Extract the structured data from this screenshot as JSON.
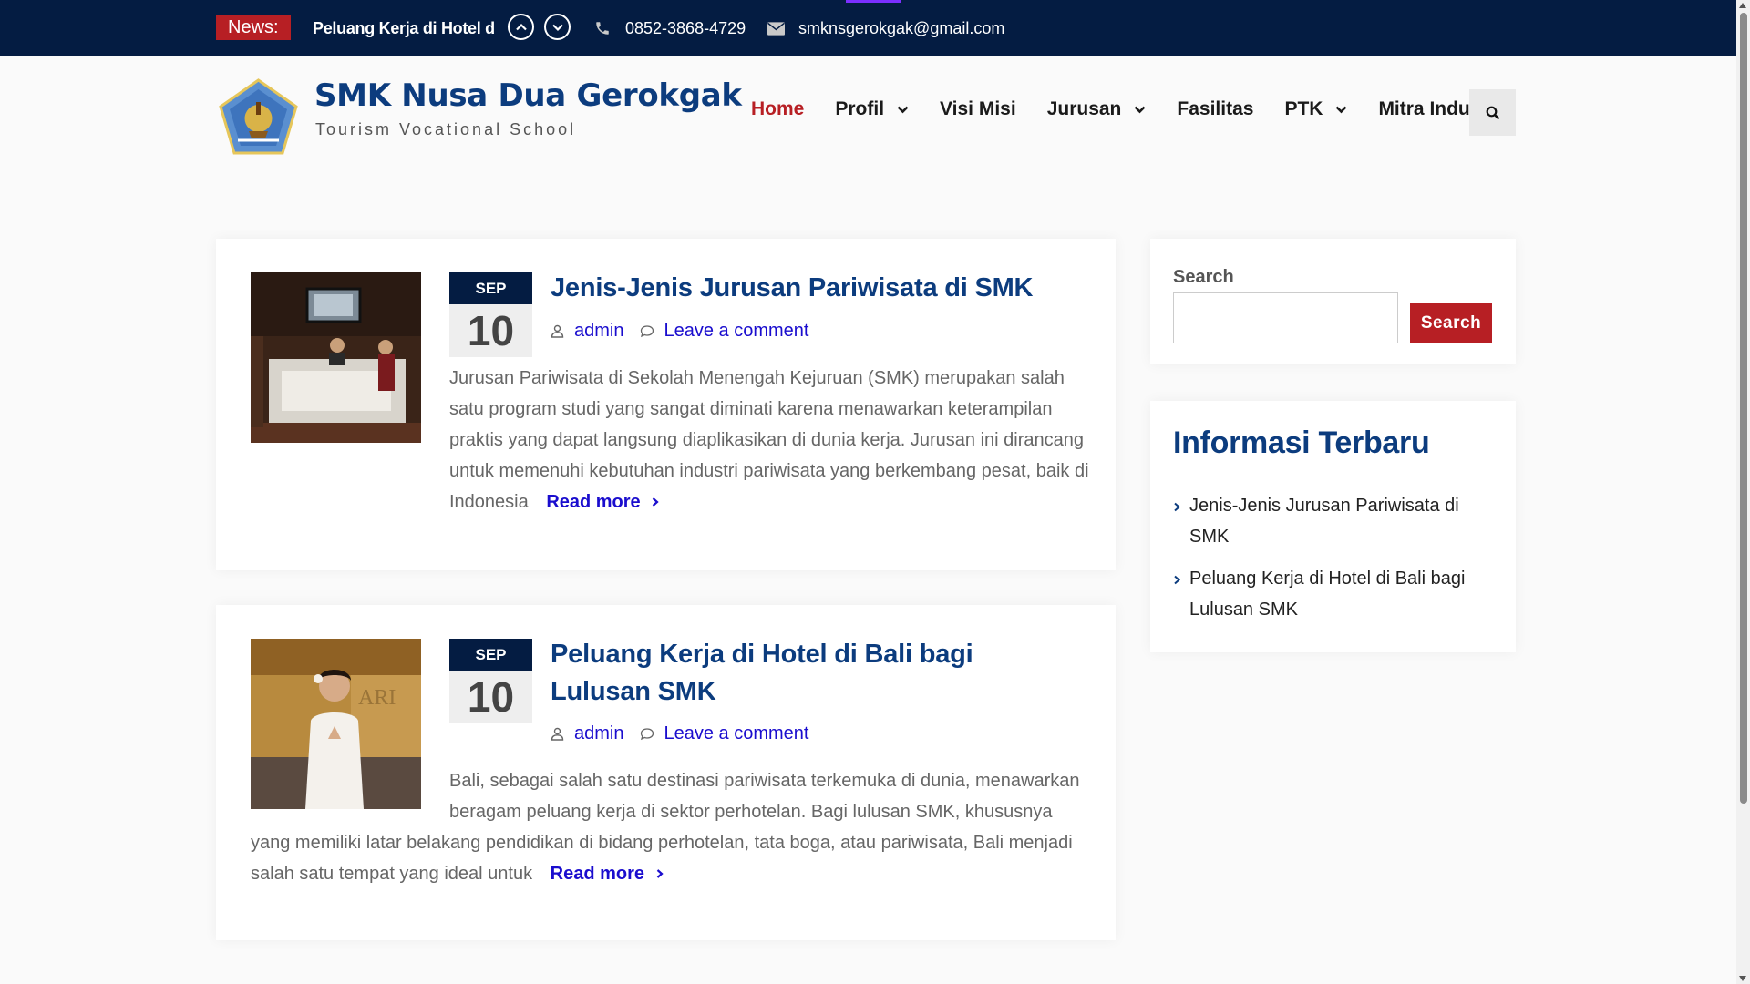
{
  "topbar": {
    "news_label": "News:",
    "ticker_text": "Peluang Kerja di Hotel di",
    "phone": "0852-3868-4729",
    "email": "smknsgerokgak@gmail.com"
  },
  "header": {
    "site_title": "SMK Nusa Dua Gerokgak",
    "tagline": "Tourism Vocational School",
    "nav": [
      {
        "label": "Home",
        "active": true
      },
      {
        "label": "Profil",
        "dropdown": true
      },
      {
        "label": "Visi Misi"
      },
      {
        "label": "Jurusan",
        "dropdown": true
      },
      {
        "label": "Fasilitas"
      },
      {
        "label": "PTK",
        "dropdown": true
      },
      {
        "label": "Mitra Industri"
      }
    ]
  },
  "posts": [
    {
      "month": "SEP",
      "day": "10",
      "title": "Jenis-Jenis Jurusan Pariwisata di SMK",
      "author": "admin",
      "comment_link": "Leave a comment",
      "excerpt": "Jurusan Pariwisata di Sekolah Menengah Kejuruan (SMK) merupakan salah satu program studi yang sangat diminati karena menawarkan keterampilan praktis yang dapat langsung diaplikasikan di dunia kerja. Jurusan ini dirancang untuk memenuhi kebutuhan industri pariwisata yang berkembang pesat, baik di Indonesia",
      "read_more": "Read more"
    },
    {
      "month": "SEP",
      "day": "10",
      "title": "Peluang Kerja di Hotel di Bali bagi Lulusan SMK",
      "author": "admin",
      "comment_link": "Leave a comment",
      "excerpt": "Bali, sebagai salah satu destinasi pariwisata terkemuka di dunia, menawarkan beragam peluang kerja di sektor perhotelan. Bagi lulusan SMK, khususnya yang memiliki latar belakang pendidikan di bidang perhotelan, tata boga, atau pariwisata, Bali menjadi salah satu tempat yang ideal untuk",
      "read_more": "Read more"
    }
  ],
  "sidebar": {
    "search_label": "Search",
    "search_value": "",
    "search_button": "Search",
    "recent_title": "Informasi Terbaru",
    "recent": [
      "Jenis-Jenis Jurusan Pariwisata di SMK",
      "Peluang Kerja di Hotel di Bali bagi Lulusan SMK"
    ]
  },
  "colors": {
    "topbar": "#041c42",
    "accent_red": "#b71f24",
    "title_blue": "#0c3c7e",
    "link_blue": "#1a0dce"
  }
}
